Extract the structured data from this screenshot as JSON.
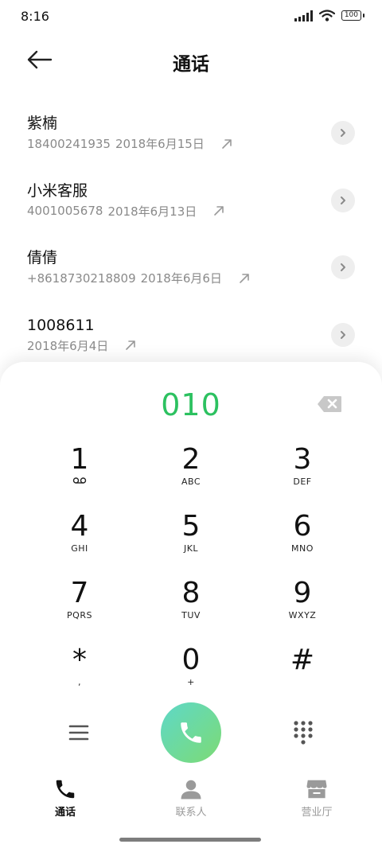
{
  "status_bar": {
    "time": "8:16",
    "battery": "100"
  },
  "header": {
    "title": "通话"
  },
  "calls": [
    {
      "name": "紫楠",
      "number": "18400241935",
      "date": "2018年6月15日"
    },
    {
      "name": "小米客服",
      "number": "4001005678",
      "date": "2018年6月13日"
    },
    {
      "name": "倩倩",
      "number": "+8618730218809",
      "date": "2018年6月6日"
    },
    {
      "name": "1008611",
      "number": "",
      "date": "2018年6月4日"
    }
  ],
  "dialer": {
    "input": "010",
    "keys": [
      {
        "digit": "1",
        "letters": "voicemail"
      },
      {
        "digit": "2",
        "letters": "ABC"
      },
      {
        "digit": "3",
        "letters": "DEF"
      },
      {
        "digit": "4",
        "letters": "GHI"
      },
      {
        "digit": "5",
        "letters": "JKL"
      },
      {
        "digit": "6",
        "letters": "MNO"
      },
      {
        "digit": "7",
        "letters": "PQRS"
      },
      {
        "digit": "8",
        "letters": "TUV"
      },
      {
        "digit": "9",
        "letters": "WXYZ"
      },
      {
        "digit": "*",
        "letters": ","
      },
      {
        "digit": "0",
        "letters": "+"
      },
      {
        "digit": "#",
        "letters": ""
      }
    ]
  },
  "tabs": [
    {
      "label": "通话",
      "icon": "phone-icon",
      "active": true
    },
    {
      "label": "联系人",
      "icon": "person-icon",
      "active": false
    },
    {
      "label": "营业厅",
      "icon": "store-icon",
      "active": false
    }
  ],
  "colors": {
    "accent_green": "#2cc160",
    "call_gradient_start": "#5ed8c8",
    "call_gradient_end": "#7ddb74"
  }
}
